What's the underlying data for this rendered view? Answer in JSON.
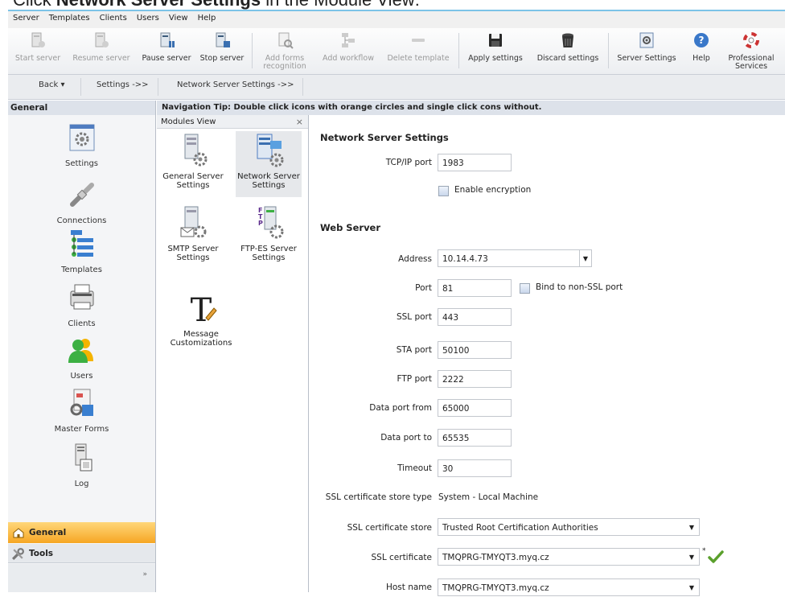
{
  "caption": {
    "prefix": "Click ",
    "bold": "Network Server Settings",
    "suffix": " in the Module View:"
  },
  "menubar": [
    "Server",
    "Templates",
    "Clients",
    "Users",
    "View",
    "Help"
  ],
  "toolbar": {
    "start_server": "Start server",
    "resume_server": "Resume server",
    "pause_server": "Pause server",
    "stop_server": "Stop server",
    "add_forms_recognition": [
      "Add forms",
      "recognition"
    ],
    "add_workflow": "Add workflow",
    "delete_template": "Delete template",
    "apply_settings": "Apply settings",
    "discard_settings": "Discard settings",
    "server_settings": "Server Settings",
    "help": "Help",
    "professional_services": [
      "Professional",
      "Services"
    ]
  },
  "navbar": {
    "back": "Back",
    "settings": "Settings ->>",
    "network": "Network Server Settings ->>"
  },
  "tip": "Navigation Tip: Double click icons with orange circles and single click cons without.",
  "left_pane": {
    "header": "General",
    "items": [
      "Settings",
      "Connections",
      "Templates",
      "Clients",
      "Users",
      "Master Forms",
      "Log"
    ],
    "general": "General",
    "tools": "Tools"
  },
  "modules": {
    "header": "Modules View",
    "close": "×",
    "items": [
      [
        "General Server",
        "Settings"
      ],
      [
        "Network Server",
        "Settings"
      ],
      [
        "SMTP Server",
        "Settings"
      ],
      [
        "FTP-ES Server",
        "Settings"
      ],
      [
        "Message",
        "Customizations"
      ]
    ]
  },
  "settings": {
    "section1": "Network Server Settings",
    "tcp_label": "TCP/IP port",
    "tcp_value": "1983",
    "enc_label": "Enable encryption",
    "section2": "Web Server",
    "address_label": "Address",
    "address_value": "10.14.4.73",
    "port_label": "Port",
    "port_value": "81",
    "bind_label": "Bind to non-SSL port",
    "ssl_port_label": "SSL port",
    "ssl_port_value": "443",
    "sta_port_label": "STA port",
    "sta_port_value": "50100",
    "ftp_port_label": "FTP port",
    "ftp_port_value": "2222",
    "data_from_label": "Data port from",
    "data_from_value": "65000",
    "data_to_label": "Data port to",
    "data_to_value": "65535",
    "timeout_label": "Timeout",
    "timeout_value": "30",
    "store_type_label": "SSL certificate store type",
    "store_type_value": "System - Local Machine",
    "store_label": "SSL certificate store",
    "store_value": "Trusted Root Certification Authorities",
    "cert_label": "SSL certificate",
    "cert_value": "TMQPRG-TMYQT3.myq.cz",
    "cert_mark": "*",
    "host_label": "Host name",
    "host_value": "TMQPRG-TMYQT3.myq.cz"
  },
  "colors": {
    "accent_orange": "#f6a623",
    "title_blue": "#7cc3e8",
    "check_green": "#5aa02c"
  }
}
